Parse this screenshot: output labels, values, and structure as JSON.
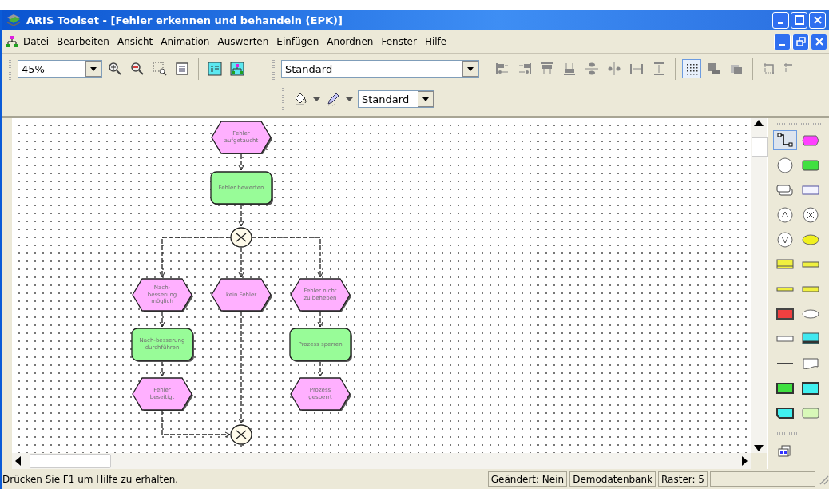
{
  "window": {
    "title": "ARIS Toolset - [Fehler erkennen und behandeln (EPK)]"
  },
  "menu": [
    {
      "label": "Datei"
    },
    {
      "label": "Bearbeiten"
    },
    {
      "label": "Ansicht"
    },
    {
      "label": "Animation"
    },
    {
      "label": "Auswerten"
    },
    {
      "label": "Einfügen"
    },
    {
      "label": "Anordnen"
    },
    {
      "label": "Fenster"
    },
    {
      "label": "Hilfe"
    }
  ],
  "toolbar": {
    "zoom": "45%",
    "style": "Standard",
    "line_style": "Standard",
    "grid_on": true
  },
  "diagram": {
    "nodes": [
      {
        "kind": "event",
        "label": "Fehler aufgetaucht"
      },
      {
        "kind": "function",
        "label": "Fehler bewerten"
      },
      {
        "kind": "xor"
      },
      {
        "kind": "event",
        "label": "Nach-besserung möglich"
      },
      {
        "kind": "event",
        "label": "kein Fehler"
      },
      {
        "kind": "event",
        "label": "Fehler nicht zu beheben"
      },
      {
        "kind": "function",
        "label": "Nach-besserung durchführen"
      },
      {
        "kind": "function",
        "label": "Prozess sperren"
      },
      {
        "kind": "event",
        "label": "Fehler beseitigt"
      },
      {
        "kind": "event",
        "label": "Prozess gesperrt"
      },
      {
        "kind": "xor"
      }
    ]
  },
  "palette": [
    {
      "kind": "connection",
      "selected": true
    },
    {
      "kind": "event",
      "selected": false
    },
    {
      "kind": "circle",
      "selected": false
    },
    {
      "kind": "function",
      "selected": false
    },
    {
      "kind": "stack",
      "selected": false
    },
    {
      "kind": "box",
      "selected": false
    },
    {
      "kind": "and",
      "selected": false
    },
    {
      "kind": "xor",
      "selected": false
    },
    {
      "kind": "or",
      "selected": false
    },
    {
      "kind": "cloud",
      "selected": false
    },
    {
      "kind": "tray",
      "selected": false
    },
    {
      "kind": "bar",
      "selected": false
    },
    {
      "kind": "strip",
      "selected": false
    },
    {
      "kind": "bar",
      "selected": false
    },
    {
      "kind": "block",
      "selected": false
    },
    {
      "kind": "oval",
      "selected": false
    },
    {
      "kind": "slot",
      "selected": false
    },
    {
      "kind": "screen",
      "selected": false
    },
    {
      "kind": "line",
      "selected": false
    },
    {
      "kind": "document",
      "selected": false
    },
    {
      "kind": "card",
      "selected": false
    },
    {
      "kind": "panel",
      "selected": false
    },
    {
      "kind": "note",
      "selected": false
    },
    {
      "kind": "tile",
      "selected": false
    }
  ],
  "status_bar": {
    "message": "Drücken Sie F1 um Hilfe zu erhalten.",
    "panes": [
      "Geändert: Nein",
      "Demodatenbank",
      "Raster: 5"
    ]
  }
}
